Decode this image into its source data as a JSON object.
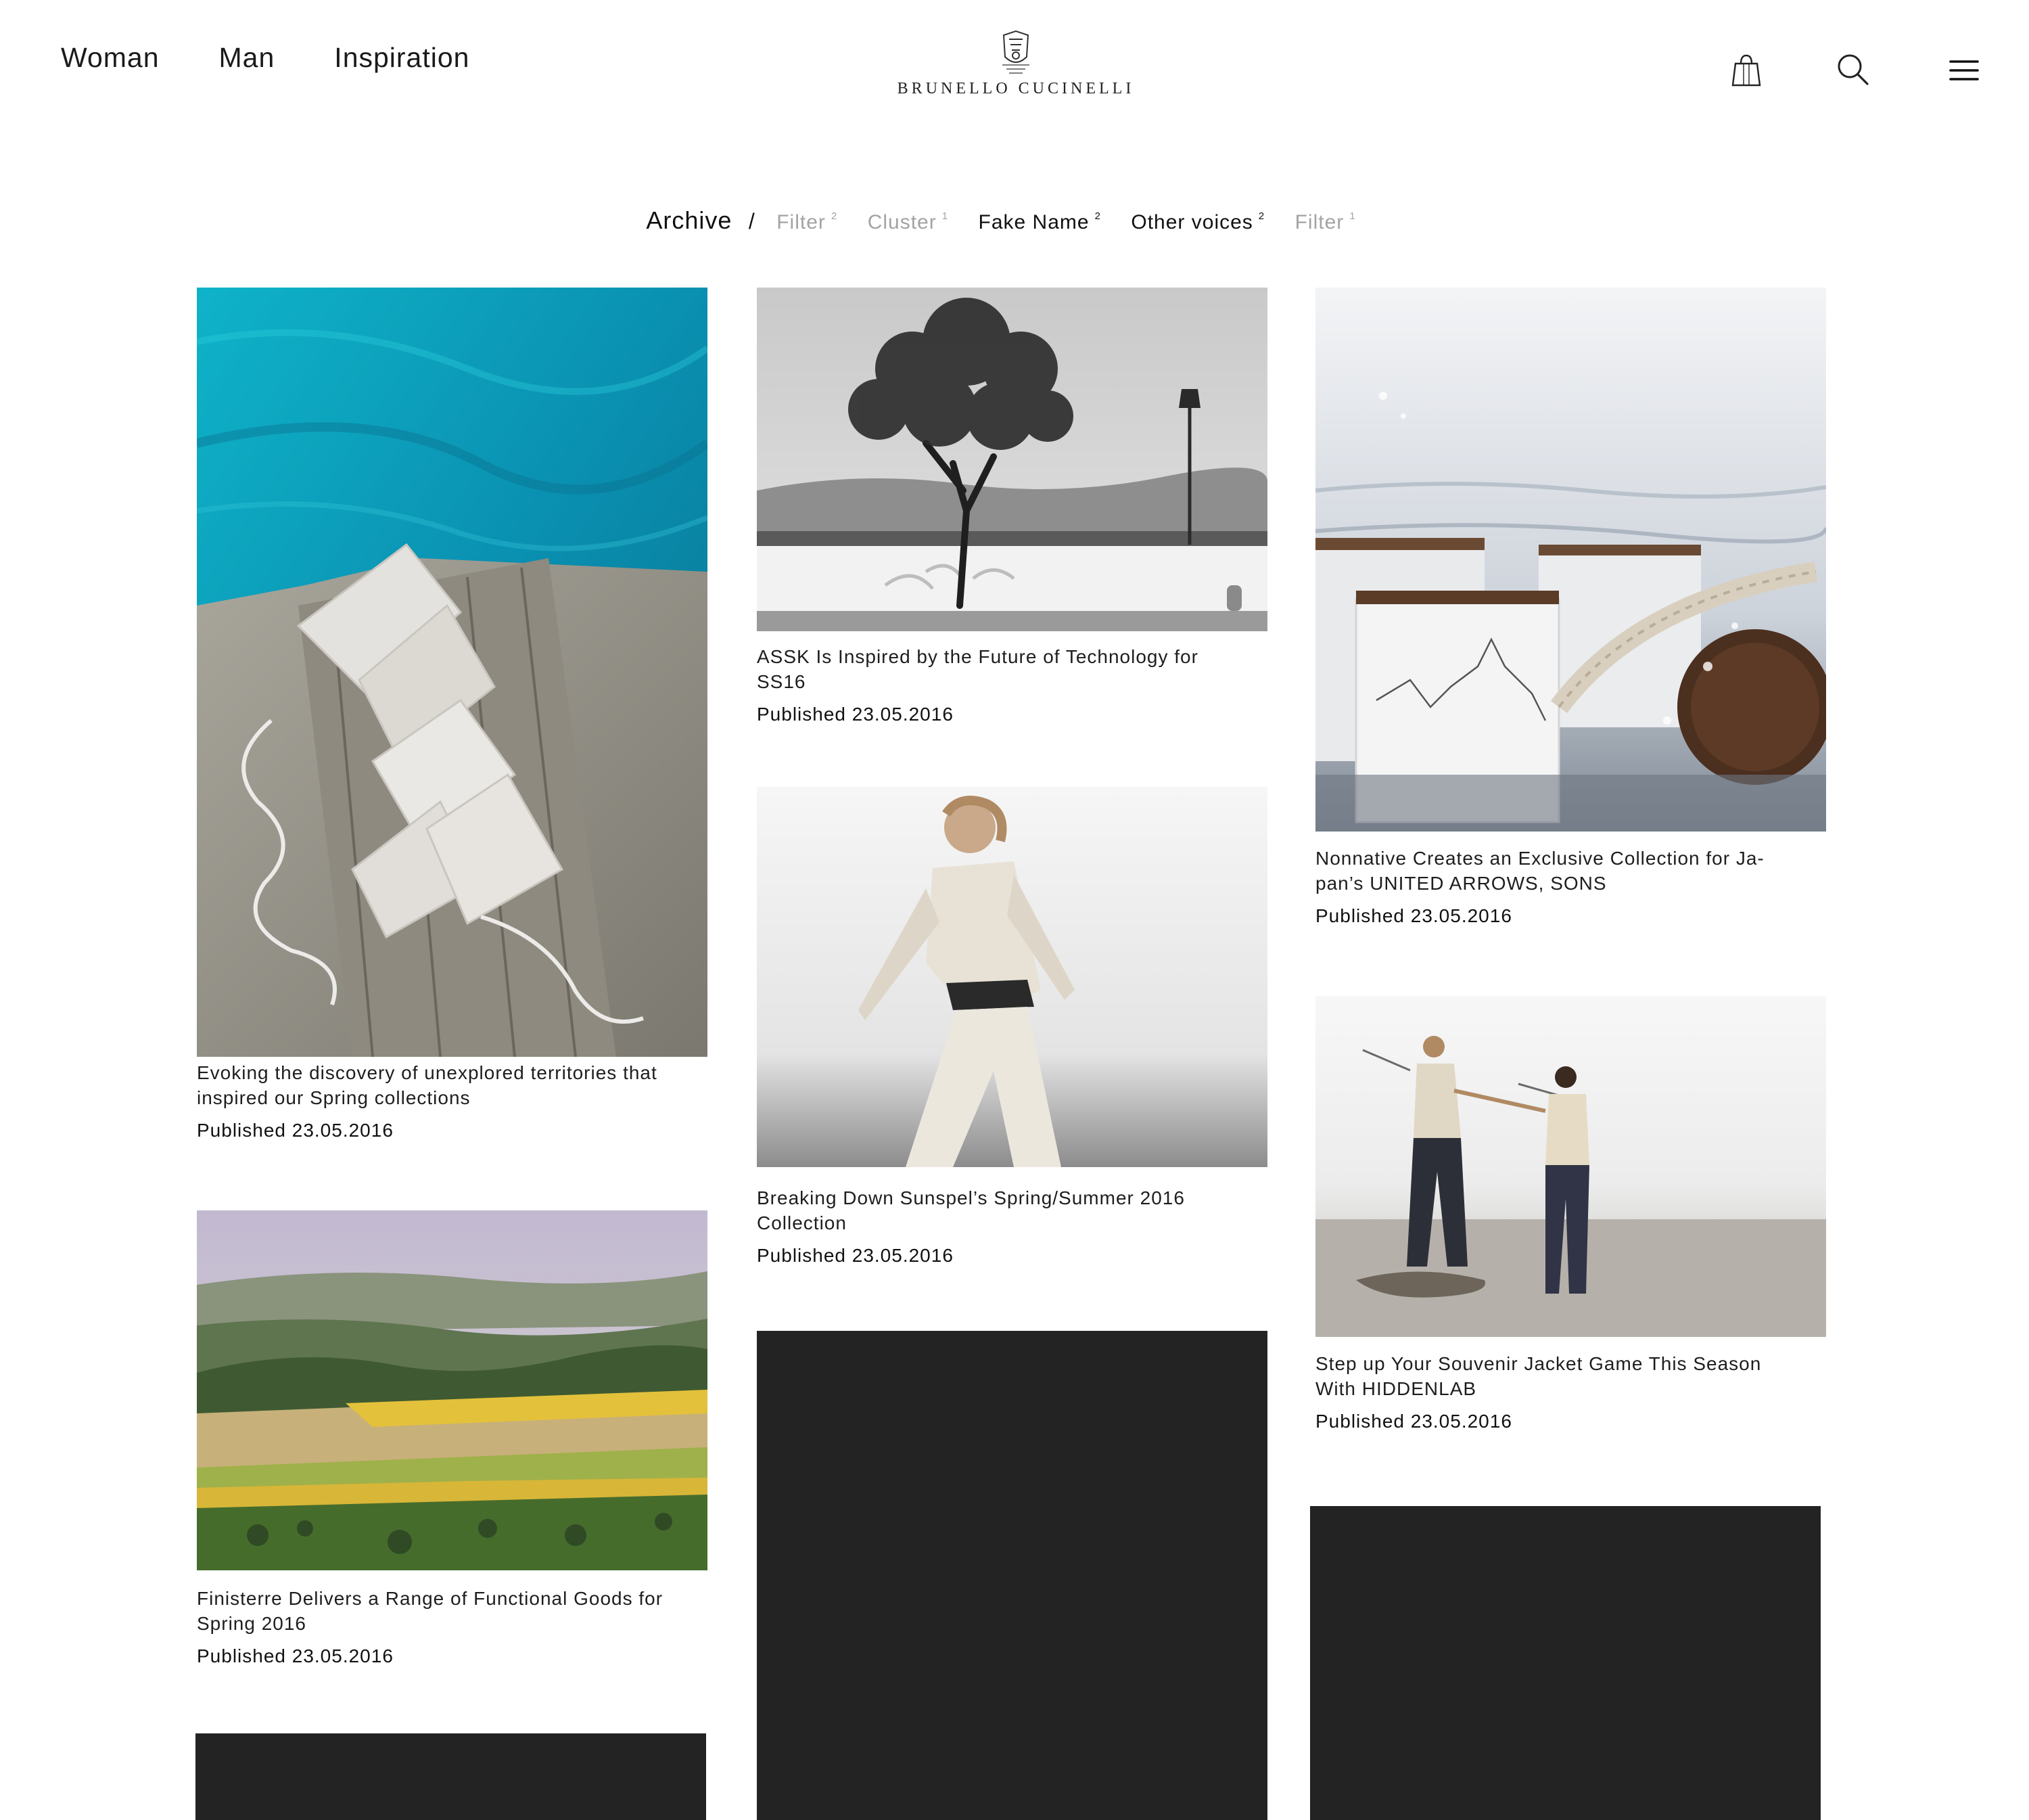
{
  "nav": {
    "woman": "Woman",
    "man": "Man",
    "inspiration": "Inspiration"
  },
  "brand": {
    "name": "BRUNELLO CUCINELLI"
  },
  "icons": {
    "bag": "shopping-bag-icon",
    "search": "search-icon",
    "menu": "hamburger-menu-icon"
  },
  "archive": {
    "title": "Archive",
    "separator": "/",
    "filters": [
      {
        "label": "Filter",
        "count": "2",
        "state": "dim"
      },
      {
        "label": "Cluster",
        "count": "1",
        "state": "dim"
      },
      {
        "label": "Fake Name",
        "count": "2",
        "state": "active"
      },
      {
        "label": "Other voices",
        "count": "2",
        "state": "active"
      },
      {
        "label": "Filter",
        "count": "1",
        "state": "dim"
      }
    ]
  },
  "articles": [
    {
      "title": "Evoking the discovery of unexplored territories that inspired our Spring collections",
      "date": "Published 23.05.2016"
    },
    {
      "title": "ASSK Is Inspired by the Future of Technology for SS16",
      "date": "Published 23.05.2016"
    },
    {
      "title": "Nonnative Creates an Exclusive Collection for Ja-pan’s UNITED ARROWS, SONS",
      "date": "Published 23.05.2016"
    },
    {
      "title": "Breaking Down Sunspel’s Spring/Summer 2016 Collection",
      "date": "Published 23.05.2016"
    },
    {
      "title": "Step up Your Souvenir Jacket Game This Season With HIDDENLAB",
      "date": "Published 23.05.2016"
    },
    {
      "title": "Finisterre Delivers a Range of Functional Goods for Spring 2016",
      "date": "Published 23.05.2016"
    }
  ],
  "colors": {
    "text": "#1a1a1a",
    "muted": "#a3a3a3",
    "placeholder": "#232323"
  }
}
